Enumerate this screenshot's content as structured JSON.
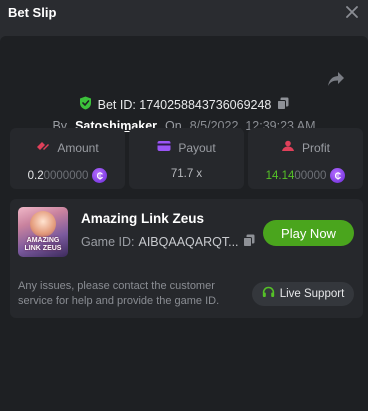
{
  "header": {
    "title": "Bet Slip"
  },
  "bet": {
    "id_label": "Bet ID: 1740258843736069248",
    "by_label": "By",
    "username": "Satoshimaker",
    "on_label": "On",
    "datetime": "8/5/2022, 12:39:23 AM"
  },
  "stats": {
    "amount": {
      "label": "Amount",
      "value_strong": "0.2",
      "value_dim": "0000000",
      "currency_icon": "coin-icon"
    },
    "payout": {
      "label": "Payout",
      "value": "71.7 x"
    },
    "profit": {
      "label": "Profit",
      "value_strong": "14.14",
      "value_dim": "00000",
      "currency_icon": "coin-icon"
    }
  },
  "game": {
    "name": "Amazing Link Zeus",
    "id_label": "Game ID:",
    "id_value": "AIBQAAQARQT...",
    "thumb_text_line1": "AMAZING",
    "thumb_text_line2": "LINK ZEUS",
    "play_label": "Play Now",
    "notice": "Any issues, please contact the customer service for help and provide the game ID.",
    "support_label": "Live Support"
  },
  "colors": {
    "accent_green": "#4aa51d",
    "profit_green": "#55c227",
    "coin_purple": "#8a3cf0"
  }
}
